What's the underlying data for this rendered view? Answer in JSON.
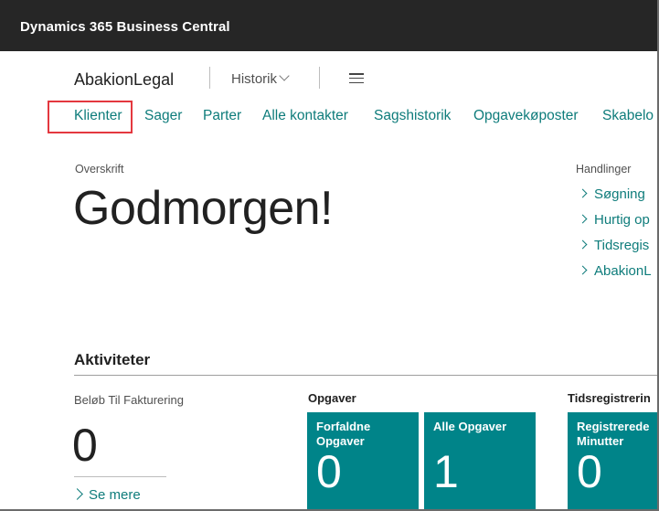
{
  "app": {
    "title": "Dynamics 365 Business Central"
  },
  "header": {
    "company": "AbakionLegal",
    "history": "Historik",
    "menu_icon": "hamburger-menu-icon"
  },
  "nav": {
    "items": [
      {
        "label": "Klienter"
      },
      {
        "label": "Sager"
      },
      {
        "label": "Parter"
      },
      {
        "label": "Alle kontakter"
      },
      {
        "label": "Sagshistorik"
      },
      {
        "label": "Opgavekøposter"
      },
      {
        "label": "Skabelo"
      }
    ]
  },
  "headline": {
    "caption": "Overskrift",
    "greeting": "Godmorgen!"
  },
  "actions": {
    "caption": "Handlinger",
    "items": [
      {
        "label": "Søgning"
      },
      {
        "label": "Hurtig op"
      },
      {
        "label": "Tidsregis"
      },
      {
        "label": "AbakionL"
      }
    ]
  },
  "activities": {
    "title": "Aktiviteter",
    "kpi": {
      "label": "Beløb Til Fakturering",
      "value": "0",
      "see_more": "Se mere"
    },
    "groups": [
      {
        "title": "Opgaver",
        "tiles": [
          {
            "label": "Forfaldne Opgaver",
            "value": "0"
          },
          {
            "label": "Alle Opgaver",
            "value": "1"
          }
        ]
      },
      {
        "title": "Tidsregistrerin",
        "tiles": [
          {
            "label": "Registrerede Minutter",
            "value": "0"
          }
        ]
      }
    ]
  },
  "colors": {
    "accent": "#0e7c7b",
    "tile": "#008489",
    "topbar": "#262626",
    "highlight": "#e4383f"
  }
}
